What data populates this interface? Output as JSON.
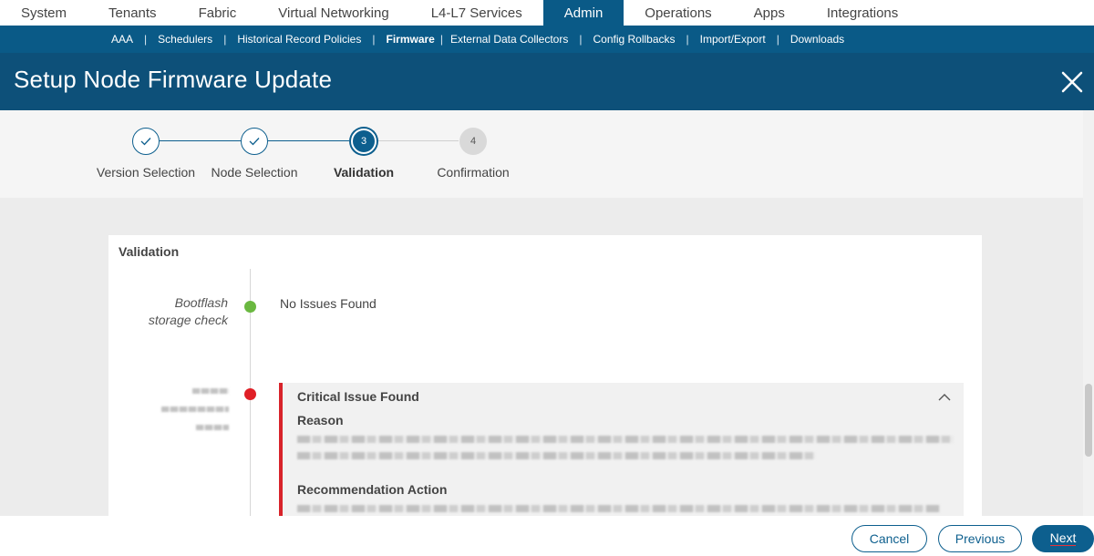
{
  "top_nav": {
    "tabs": [
      {
        "label": "System"
      },
      {
        "label": "Tenants"
      },
      {
        "label": "Fabric"
      },
      {
        "label": "Virtual Networking"
      },
      {
        "label": "L4-L7 Services"
      },
      {
        "label": "Admin",
        "active": true
      },
      {
        "label": "Operations"
      },
      {
        "label": "Apps"
      },
      {
        "label": "Integrations"
      }
    ]
  },
  "sub_nav": {
    "items": [
      {
        "label": "AAA"
      },
      {
        "label": "Schedulers"
      },
      {
        "label": "Historical Record Policies"
      },
      {
        "label": "Firmware",
        "active": true
      },
      {
        "label": "External Data Collectors"
      },
      {
        "label": "Config Rollbacks"
      },
      {
        "label": "Import/Export"
      },
      {
        "label": "Downloads"
      }
    ]
  },
  "header": {
    "title": "Setup Node Firmware Update"
  },
  "stepper": {
    "steps": [
      {
        "number": "1",
        "label": "Version Selection",
        "state": "done"
      },
      {
        "number": "2",
        "label": "Node Selection",
        "state": "done"
      },
      {
        "number": "3",
        "label": "Validation",
        "state": "current"
      },
      {
        "number": "4",
        "label": "Confirmation",
        "state": "pending"
      }
    ]
  },
  "validation": {
    "title": "Validation",
    "checks": [
      {
        "name_line1": "Bootflash",
        "name_line2": "storage check",
        "status": "green",
        "result": "No Issues Found"
      },
      {
        "status": "red"
      }
    ],
    "issue": {
      "title": "Critical Issue Found",
      "reason_label": "Reason",
      "recommendation_label": "Recommendation Action"
    }
  },
  "footer": {
    "cancel_label": "Cancel",
    "previous_label": "Previous",
    "next_label": "Next"
  },
  "colors": {
    "brand": "#0a5a87",
    "header": "#0d5079",
    "success": "#6ab840",
    "critical": "#e01f26"
  }
}
